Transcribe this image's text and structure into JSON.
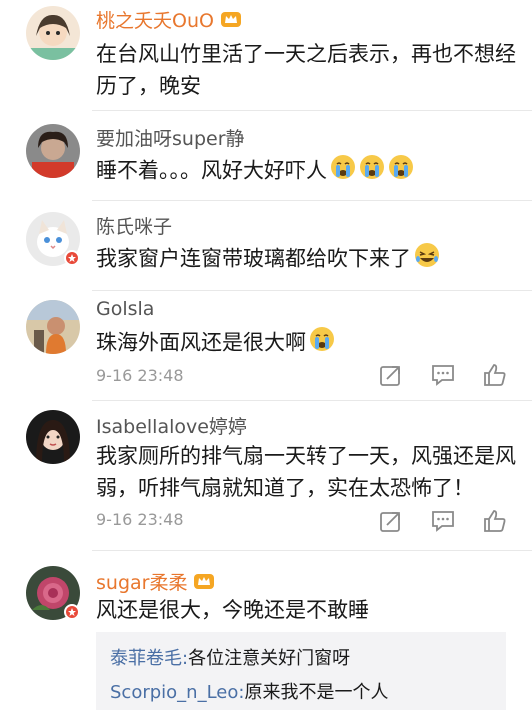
{
  "comments": [
    {
      "username": "桃之夭夭OuO",
      "text": "在台风山竹里活了一天之后表示，再也不想经历了，晚安"
    },
    {
      "username": "要加油呀super静",
      "text": "睡不着。。。风好大好吓人"
    },
    {
      "username": "陈氏咪子",
      "text": "我家窗户连窗带玻璃都给吹下来了"
    },
    {
      "username": "Golsla",
      "text": "珠海外面风还是很大啊",
      "time": "9-16 23:48"
    },
    {
      "username": "Isabellalove婷婷",
      "text": "我家厕所的排气扇一天转了一天，风强还是风弱，听排气扇就知道了，实在太恐怖了！",
      "time": "9-16 23:48"
    },
    {
      "username": "sugar柔柔",
      "text": "风还是很大，今晚还是不敢睡"
    }
  ],
  "replies": [
    {
      "name": "泰菲卷毛",
      "sep": ":",
      "text": "各位注意关好门窗呀"
    },
    {
      "name": "Scorpio_n_Leo",
      "sep": ":",
      "text": "原来我不是一个人"
    }
  ],
  "icons": {
    "repost": "repost-icon",
    "comment": "comment-icon",
    "like": "like-icon",
    "crying": "crying-emoji-icon",
    "laughing": "laughing-emoji-icon",
    "crown": "vip-crown-icon"
  },
  "colors": {
    "username_vip": "#e8772e",
    "username_normal": "#555555",
    "reply_name": "#4a6fa5",
    "verified_badge": "#f0a020"
  }
}
